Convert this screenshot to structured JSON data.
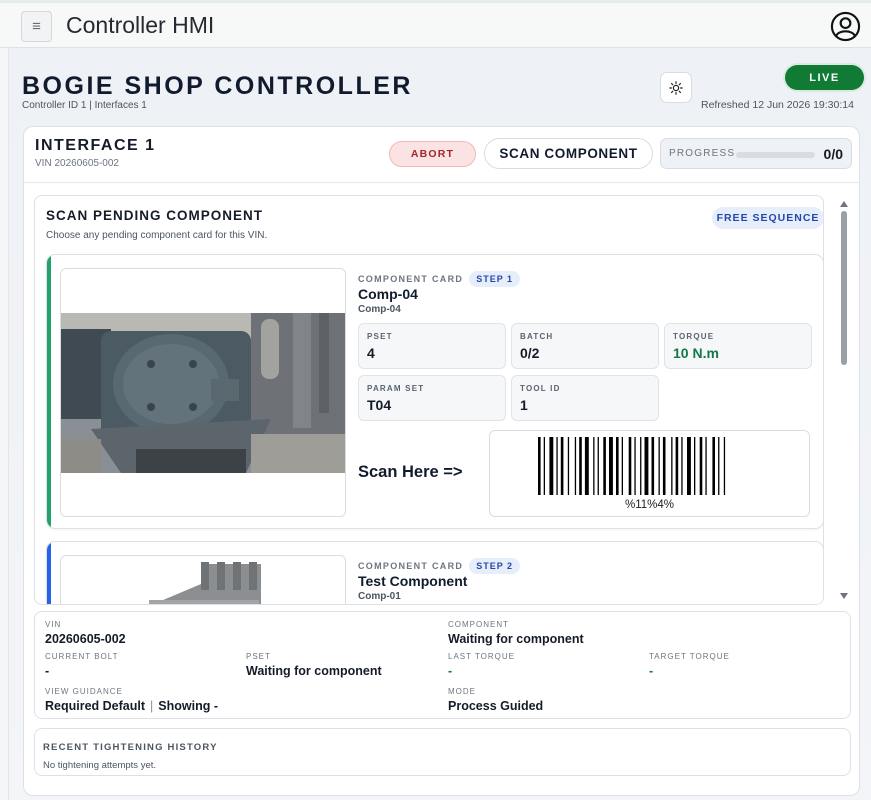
{
  "app": {
    "title": "Controller HMI"
  },
  "header": {
    "title": "BOGIE SHOP CONTROLLER",
    "subtitle": "Controller ID 1 | Interfaces 1",
    "live_label": "LIVE",
    "refreshed": "Refreshed 12 Jun 2026 19:30:14"
  },
  "interface": {
    "title": "INTERFACE 1",
    "vin": "VIN 20260605-002",
    "abort_label": "ABORT",
    "scan_label": "SCAN COMPONENT",
    "progress_label": "PROGRESS",
    "progress_value": "0/0",
    "progress_fraction": 0
  },
  "scan_panel": {
    "title": "SCAN PENDING COMPONENT",
    "subtitle": "Choose any pending component card for this VIN.",
    "mode_badge": "FREE SEQUENCE",
    "cards": [
      {
        "label": "COMPONENT CARD",
        "step": "STEP 1",
        "name": "Comp-04",
        "code": "Comp-04",
        "params": [
          {
            "label": "PSET",
            "value": "4"
          },
          {
            "label": "BATCH",
            "value": "0/2"
          },
          {
            "label": "TORQUE",
            "value": "10 N.m"
          },
          {
            "label": "PARAM SET",
            "value": "T04"
          },
          {
            "label": "TOOL ID",
            "value": "1"
          }
        ],
        "scan_prompt": "Scan Here =>",
        "barcode_text": "%11%4%",
        "accent_color": "#1fa36b"
      },
      {
        "label": "COMPONENT CARD",
        "step": "STEP 2",
        "name": "Test Component",
        "code": "Comp-01",
        "accent_color": "#2563eb"
      }
    ]
  },
  "status": {
    "vin_label": "VIN",
    "vin_value": "20260605-002",
    "component_label": "COMPONENT",
    "component_value": "Waiting for component",
    "current_bolt_label": "CURRENT BOLT",
    "current_bolt_value": "-",
    "pset_label": "PSET",
    "pset_value": "Waiting for component",
    "last_torque_label": "LAST TORQUE",
    "last_torque_value": "-",
    "target_torque_label": "TARGET TORQUE",
    "target_torque_value": "-",
    "view_guidance_label": "VIEW GUIDANCE",
    "view_guidance_value": "Required Default",
    "view_guidance_sep": "|",
    "view_guidance_showing": "Showing -",
    "mode_label": "MODE",
    "mode_value": "Process Guided"
  },
  "history": {
    "title": "RECENT TIGHTENING HISTORY",
    "empty": "No tightening attempts yet."
  },
  "colors": {
    "live": "#117a35",
    "abort_text": "#a3262a",
    "accent_blue": "#2563eb",
    "torque_green": "#127a45"
  },
  "icons": {
    "menu": "hamburger-icon",
    "profile": "user-circle-icon",
    "theme": "sun-icon"
  }
}
